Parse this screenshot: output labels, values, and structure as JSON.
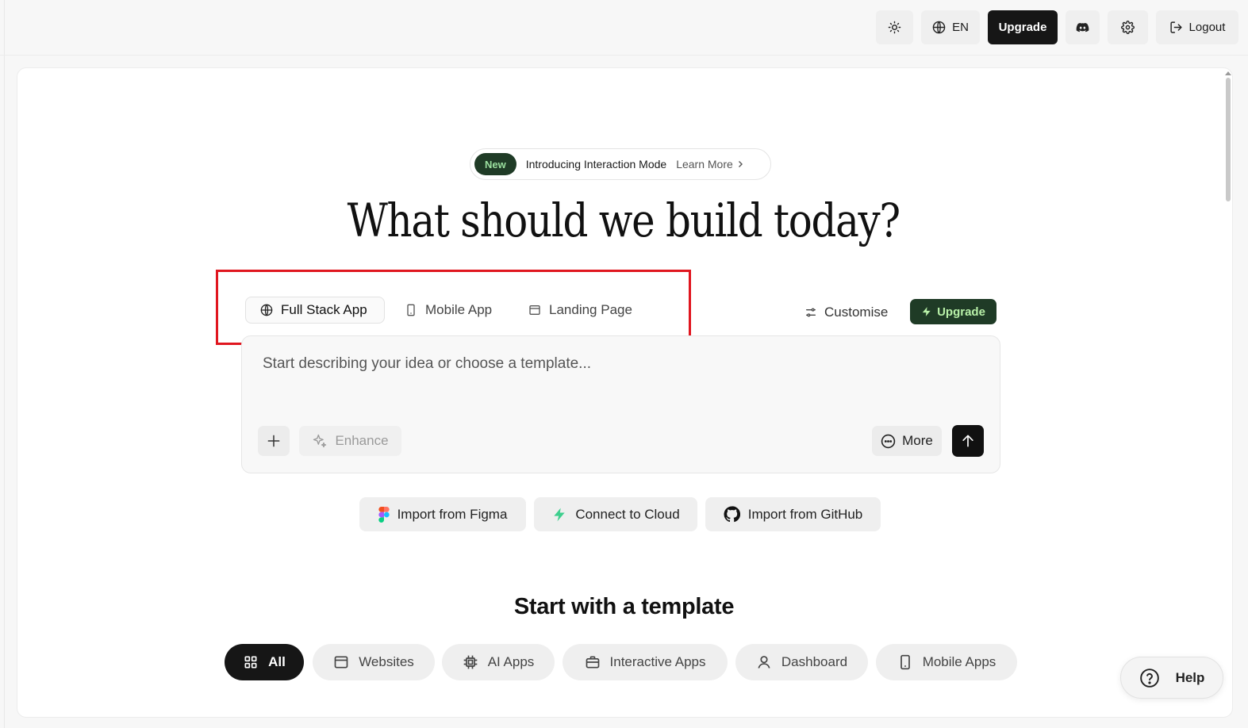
{
  "topbar": {
    "language": "EN",
    "upgrade": "Upgrade",
    "logout": "Logout"
  },
  "announcement": {
    "badge": "New",
    "text": "Introducing Interaction Mode",
    "link": "Learn More"
  },
  "headline": "What should we build today?",
  "modes": {
    "full_stack": "Full Stack App",
    "mobile": "Mobile App",
    "landing": "Landing Page"
  },
  "customise": "Customise",
  "upgrade_green": "Upgrade",
  "prompt": {
    "placeholder": "Start describing your idea or choose a template...",
    "enhance": "Enhance",
    "more": "More"
  },
  "imports": {
    "figma": "Import from Figma",
    "cloud": "Connect to Cloud",
    "github": "Import from GitHub"
  },
  "templates": {
    "title": "Start with a template",
    "all": "All",
    "websites": "Websites",
    "ai_apps": "AI Apps",
    "interactive": "Interactive Apps",
    "dashboard": "Dashboard",
    "mobile_apps": "Mobile Apps"
  },
  "help": "Help",
  "colors": {
    "accent_dark": "#161616",
    "accent_green": "#1f3b26",
    "highlight_red": "#e0161f"
  }
}
